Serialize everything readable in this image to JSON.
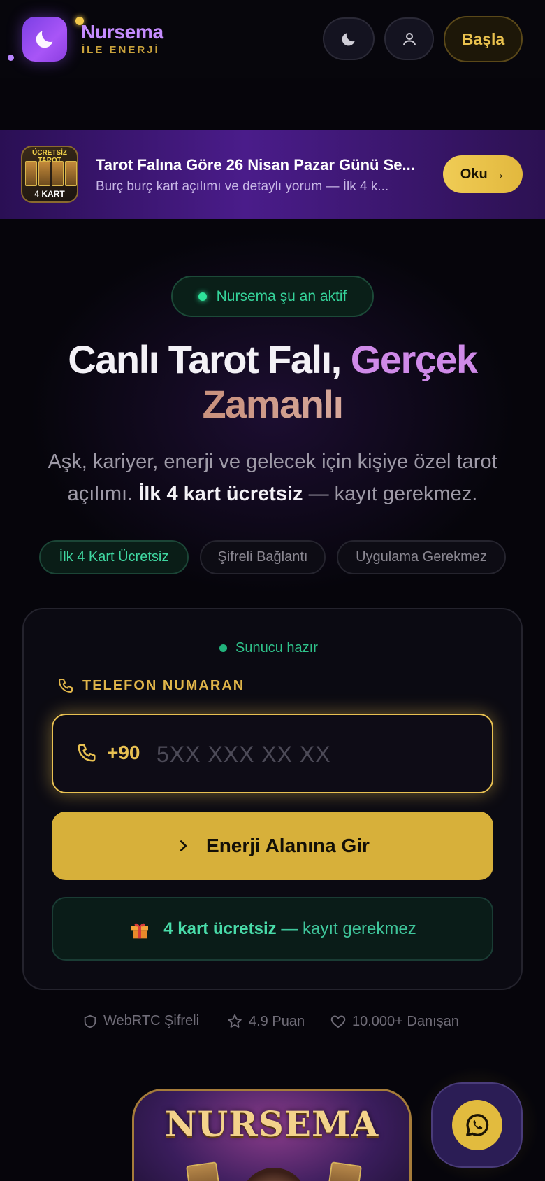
{
  "header": {
    "brand_name": "Nursema",
    "brand_sub": "İLE ENERJİ",
    "start_label": "Başla"
  },
  "promo": {
    "thumb_top": "ÜCRETSİZ TAROT",
    "thumb_bottom": "4 KART",
    "title": "Tarot Falına Göre 26 Nisan Pazar Günü Se...",
    "subtitle": "Burç burç kart açılımı ve detaylı yorum — İlk 4 k...",
    "read_label": "Oku →"
  },
  "hero": {
    "status": "Nursema şu an aktif",
    "title_part1": "Canlı Tarot Falı, ",
    "title_part2": "Gerçek",
    "title_part3": "Zamanlı",
    "desc_part1": "Aşk, kariyer, enerji ve gelecek için kişiye özel tarot açılımı. ",
    "desc_bold": "İlk 4 kart ücretsiz",
    "desc_part2": " — kayıt gerekmez.",
    "tags": [
      "İlk 4 Kart Ücretsiz",
      "Şifreli Bağlantı",
      "Uygulama Gerekmez"
    ]
  },
  "form": {
    "server_status": "Sunucu hazır",
    "phone_label": "TELEFON NUMARAN",
    "prefix": "+90",
    "phone_placeholder": "5XX XXX XX XX",
    "phone_value": "",
    "enter_label": "Enerji Alanına Gir",
    "free_bold": "4 kart ücretsiz",
    "free_rest": " — kayıt gerekmez"
  },
  "trust": {
    "webrtc": "WebRTC Şifreli",
    "rating": "4.9 Puan",
    "clients": "10.000+ Danışan"
  },
  "showcase": {
    "image_word": "NURSEMA"
  },
  "colors": {
    "accent_gold": "#e8c152",
    "accent_purple": "#c58cff",
    "status_green": "#2ee39a",
    "background": "#06050b"
  },
  "icons": {
    "logo": "moon-icon",
    "theme_toggle": "moon-icon",
    "account": "user-icon",
    "phone": "phone-icon",
    "enter": "chevron-right-icon",
    "gift": "gift-icon",
    "shield": "shield-icon",
    "star": "star-icon",
    "heart": "heart-icon",
    "whatsapp": "whatsapp-icon"
  }
}
